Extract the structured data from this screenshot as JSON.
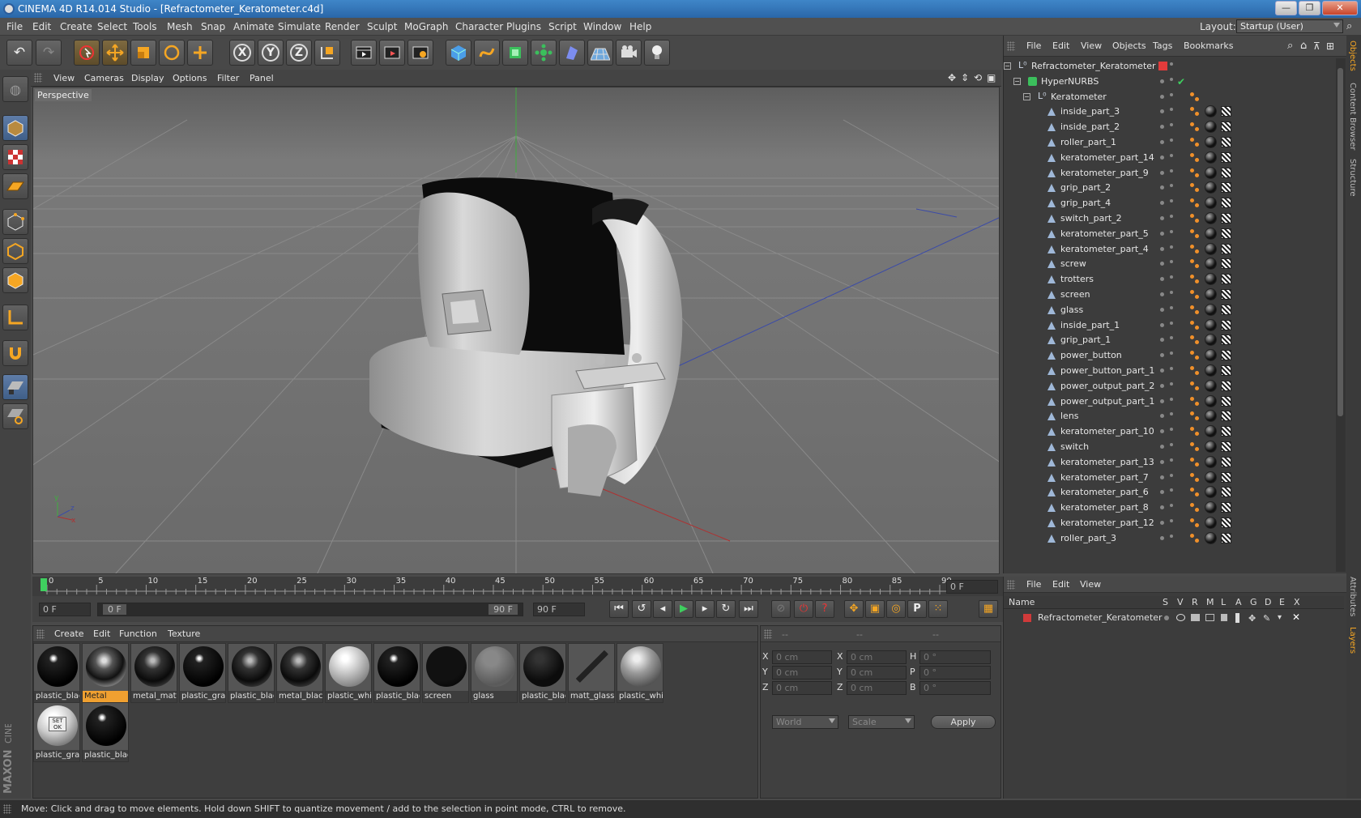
{
  "window": {
    "title": "CINEMA 4D R14.014 Studio - [Refractometer_Keratometer.c4d]",
    "minimize": "—",
    "maximize": "❐",
    "close": "✕"
  },
  "menubar": [
    "File",
    "Edit",
    "Create",
    "Select",
    "Tools",
    "Mesh",
    "Snap",
    "Animate",
    "Simulate",
    "Render",
    "Sculpt",
    "MoGraph",
    "Character",
    "Plugins",
    "Script",
    "Window",
    "Help"
  ],
  "layout": {
    "label": "Layout:",
    "value": "Startup (User)"
  },
  "toolbar": {
    "icons": [
      "undo-icon",
      "redo-icon",
      "live-selection-icon",
      "move-icon",
      "scale-icon",
      "rotate-icon",
      "last-tool-icon",
      "x-axis-icon",
      "y-axis-icon",
      "z-axis-icon",
      "coordinate-system-icon",
      "render-view-icon",
      "render-picture-viewer-icon",
      "edit-render-settings-icon",
      "cube-icon",
      "spline-pen-icon",
      "subdivision-surface-icon",
      "array-icon",
      "deformer-icon",
      "floor-icon",
      "camera-icon",
      "light-icon"
    ],
    "axis_x": "X",
    "axis_y": "Y",
    "axis_z": "Z"
  },
  "viewport": {
    "menu": [
      "View",
      "Cameras",
      "Display",
      "Options",
      "Filter",
      "Panel"
    ],
    "label": "Perspective",
    "axis_x": "x",
    "axis_y": "y",
    "axis_z": "z"
  },
  "timeline": {
    "ticks": [
      "0",
      "5",
      "10",
      "15",
      "20",
      "25",
      "30",
      "35",
      "40",
      "45",
      "50",
      "55",
      "60",
      "65",
      "70",
      "75",
      "80",
      "85",
      "90"
    ],
    "current_frame": "0 F",
    "start_frame": "0 F",
    "range_start": "0 F",
    "range_end": "90 F",
    "end_frame": "90 F"
  },
  "materials": {
    "menu": [
      "Create",
      "Edit",
      "Function",
      "Texture"
    ],
    "items": [
      {
        "label": "plastic_blac",
        "style": "black"
      },
      {
        "label": "Metal",
        "style": "chrome",
        "selected": true
      },
      {
        "label": "metal_matt",
        "style": "darkchrome"
      },
      {
        "label": "plastic_gra",
        "style": "black"
      },
      {
        "label": "plastic_blac",
        "style": "darkchrome"
      },
      {
        "label": "metal_blacl",
        "style": "darkchrome"
      },
      {
        "label": "plastic_whi",
        "style": "white"
      },
      {
        "label": "plastic_blac",
        "style": "black"
      },
      {
        "label": "screen",
        "style": "screen"
      },
      {
        "label": "glass",
        "style": "glass"
      },
      {
        "label": "plastic_blac",
        "style": "blackline"
      },
      {
        "label": "matt_glass",
        "style": "mattglass"
      },
      {
        "label": "plastic_whi",
        "style": "grey"
      },
      {
        "label": "plastic_gra",
        "style": "setok",
        "badge": "SET\nOK"
      },
      {
        "label": "plastic_blac",
        "style": "black"
      }
    ]
  },
  "attributes": {
    "header": [
      "--",
      "--",
      "--"
    ],
    "rows": [
      {
        "a": "X",
        "av": "0 cm",
        "b": "X",
        "bv": "0 cm",
        "c": "H",
        "cv": "0 °"
      },
      {
        "a": "Y",
        "av": "0 cm",
        "b": "Y",
        "bv": "0 cm",
        "c": "P",
        "cv": "0 °"
      },
      {
        "a": "Z",
        "av": "0 cm",
        "b": "Z",
        "bv": "0 cm",
        "c": "B",
        "cv": "0 °"
      }
    ],
    "world": "World",
    "scale": "Scale",
    "apply": "Apply"
  },
  "objects": {
    "menu": [
      "File",
      "Edit",
      "View",
      "Objects",
      "Tags",
      "Bookmarks"
    ],
    "root": "Refractometer_Keratometer",
    "hypernurbs": "HyperNURBS",
    "group": "Keratometer",
    "items": [
      "inside_part_3",
      "inside_part_2",
      "roller_part_1",
      "keratometer_part_14",
      "keratometer_part_9",
      "grip_part_2",
      "grip_part_4",
      "switch_part_2",
      "keratometer_part_5",
      "keratometer_part_4",
      "screw",
      "trotters",
      "screen",
      "glass",
      "inside_part_1",
      "grip_part_1",
      "power_button",
      "power_button_part_1",
      "power_output_part_2",
      "power_output_part_1",
      "lens",
      "keratometer_part_10",
      "switch",
      "keratometer_part_13",
      "keratometer_part_7",
      "keratometer_part_6",
      "keratometer_part_8",
      "keratometer_part_12",
      "roller_part_3"
    ]
  },
  "layers": {
    "menu": [
      "File",
      "Edit",
      "View"
    ],
    "columns": [
      "Name",
      "S",
      "V",
      "R",
      "M",
      "L",
      "A",
      "G",
      "D",
      "E",
      "X"
    ],
    "row": "Refractometer_Keratometer",
    "color": "#d03a3a"
  },
  "sidetabs": [
    "Objects",
    "Content Browser",
    "Structure",
    "Attributes",
    "Layers"
  ],
  "brand": {
    "maxon": "MAXON",
    "cinema": "CINEMA 4D"
  },
  "status": "Move: Click and drag to move elements. Hold down SHIFT to quantize movement / add to the selection in point mode, CTRL to remove."
}
